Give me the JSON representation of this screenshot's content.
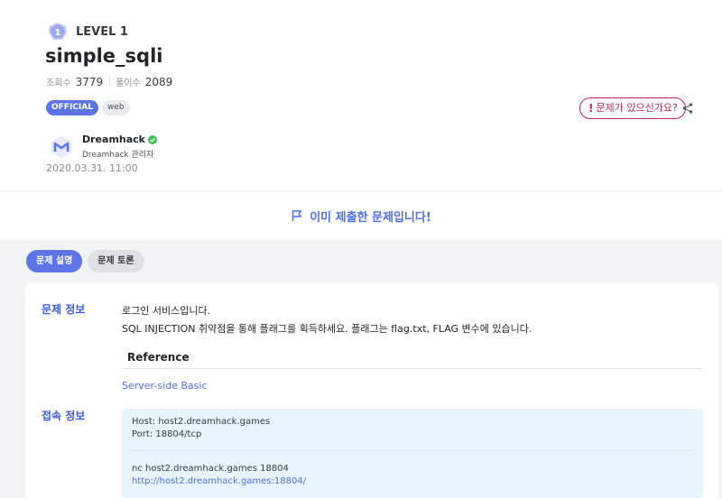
{
  "challenge": {
    "level_label": "LEVEL 1",
    "level_number": "1",
    "title": "simple_sqli",
    "views_label": "조회수",
    "views_value": "3779",
    "solves_label": "풀이수",
    "solves_value": "2089",
    "tags": [
      "OFFICIAL",
      "web"
    ],
    "report_label": "문제가 있으신가요?",
    "author_name": "Dreamhack",
    "author_role": "Dreamhack 관리자",
    "date": "2020.03.31. 11:00"
  },
  "submitted_message": "이미 제출한 문제입니다!",
  "tabs": [
    {
      "label": "문제 설명",
      "active": true
    },
    {
      "label": "문제 토론",
      "active": false
    }
  ],
  "info": {
    "section_label": "문제 정보",
    "desc_line1": "로그인 서비스입니다.",
    "desc_line2": "SQL INJECTION 취약점을 통해 플래그를 획득하세요. 플래그는 flag.txt, FLAG 변수에 있습니다.",
    "reference_title": "Reference",
    "reference_link": "Server-side Basic"
  },
  "connection": {
    "section_label": "접속 정보",
    "host": "Host: host2.dreamhack.games",
    "port": "Port: 18804/tcp",
    "nc": "nc host2.dreamhack.games 18804",
    "url": "http://host2.dreamhack.games:18804/"
  },
  "colors": {
    "accent": "#5c74e6",
    "link": "#4c6ef5",
    "report": "#c2255c",
    "verified": "#40c057"
  }
}
